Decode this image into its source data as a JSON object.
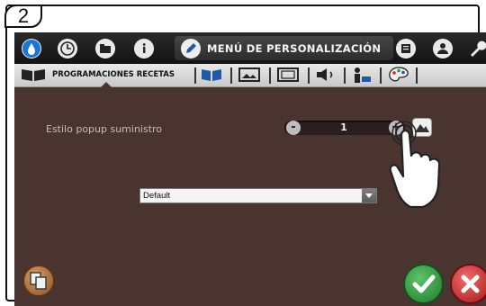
{
  "step": {
    "number": "2"
  },
  "topbar": {
    "icons": [
      "water-drop-icon",
      "clock-icon",
      "folder-icon",
      "info-icon",
      "pencil-icon",
      "notes-icon",
      "user-icon",
      "wrench-icon"
    ],
    "title": "MENÚ DE PERSONALIZACIÓN"
  },
  "subbar": {
    "active_tab": "PROGRAMACIONES RECETAS",
    "icons": [
      "book-icon",
      "book-icon",
      "image-icon",
      "frame-icon",
      "speaker-icon",
      "person-icon",
      "palette-icon"
    ]
  },
  "setting": {
    "label": "Estilo popup suministro",
    "value": "1",
    "minus": "-",
    "plus": "+"
  },
  "dropdown": {
    "selected": "Default"
  },
  "colors": {
    "background": "#4a3430",
    "accept": "#2e9b3c",
    "cancel": "#d02626"
  }
}
